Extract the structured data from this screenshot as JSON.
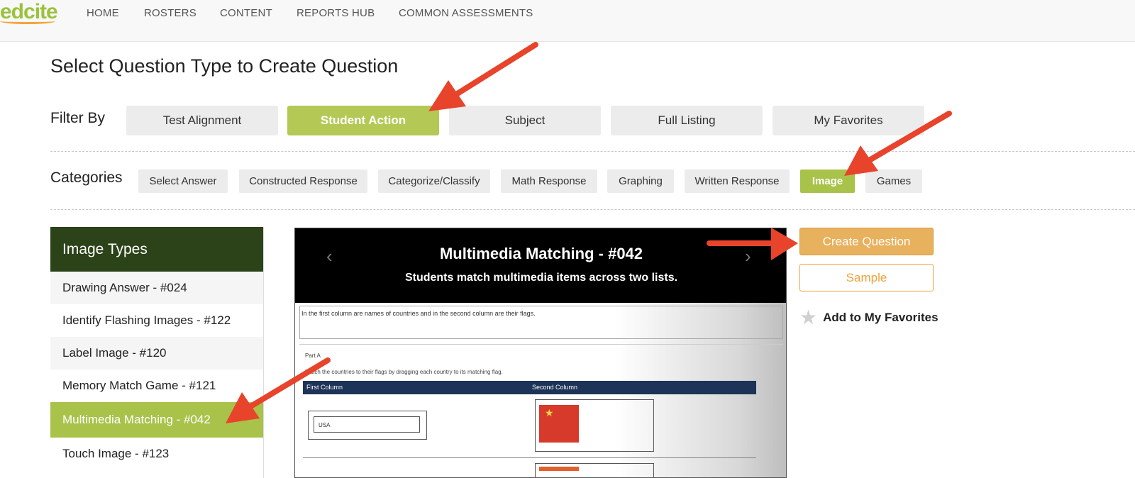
{
  "brand": {
    "logo_text": "edcite"
  },
  "nav": [
    "HOME",
    "ROSTERS",
    "CONTENT",
    "REPORTS HUB",
    "COMMON ASSESSMENTS"
  ],
  "page_title": "Select Question Type to Create Question",
  "filter": {
    "label": "Filter By",
    "options": [
      "Test Alignment",
      "Student Action",
      "Subject",
      "Full Listing",
      "My Favorites"
    ],
    "selected": "Student Action"
  },
  "categories": {
    "label": "Categories",
    "options": [
      "Select Answer",
      "Constructed Response",
      "Categorize/Classify",
      "Math Response",
      "Graphing",
      "Written Response",
      "Image",
      "Games"
    ],
    "selected": "Image"
  },
  "types": {
    "header": "Image Types",
    "items": [
      "Drawing Answer - #024",
      "Identify Flashing Images - #122",
      "Label Image - #120",
      "Memory Match Game - #121",
      "Multimedia Matching - #042",
      "Touch Image - #123"
    ],
    "selected": "Multimedia Matching - #042"
  },
  "preview": {
    "title": "Multimedia Matching - #042",
    "subtitle": "Students match multimedia items across two lists.",
    "prev_icon": "chevron-left-icon",
    "next_icon": "chevron-right-icon",
    "prompt": "In the first column are names of countries and in the second column are their flags.",
    "part": "Part A",
    "instruction": "Match the countries to their flags by dragging each country to its matching flag.",
    "column1": "First Column",
    "column2": "Second Column",
    "answer_1": "USA"
  },
  "actions": {
    "create": "Create Question",
    "sample": "Sample",
    "favorite": "Add to My Favorites",
    "favorite_icon": "star-icon"
  },
  "colors": {
    "accent_green": "#a9c24a",
    "header_dark_green": "#2c4319",
    "orange": "#e8b15e",
    "annotation_red": "#e8432b"
  }
}
